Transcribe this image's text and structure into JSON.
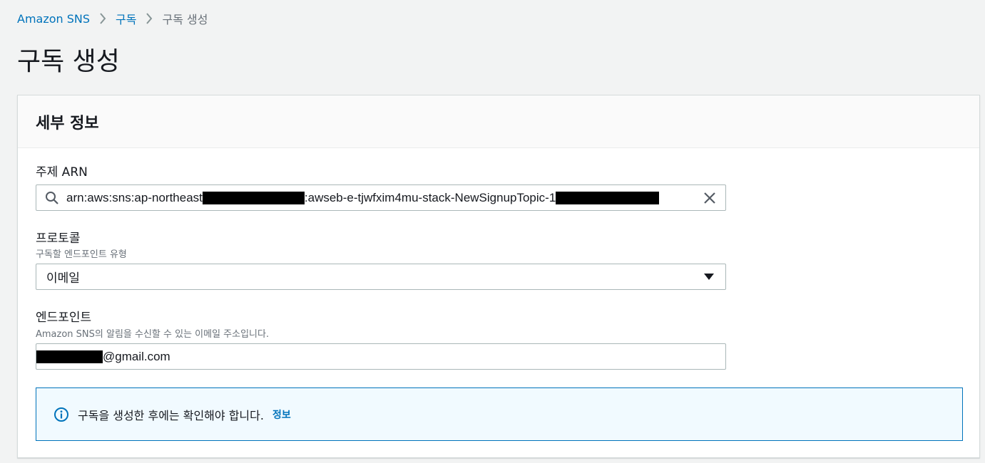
{
  "breadcrumb": {
    "items": [
      "Amazon SNS",
      "구독",
      "구독 생성"
    ]
  },
  "page": {
    "title": "구독 생성"
  },
  "details_panel": {
    "title": "세부 정보",
    "topic_arn": {
      "label": "주제 ARN",
      "value_prefix": "arn:aws:sns:ap-northeast",
      "value_middle": ":awseb-e-tjwfxim4mu-stack-NewSignupTopic-1"
    },
    "protocol": {
      "label": "프로토콜",
      "description": "구독할 엔드포인트 유형",
      "selected": "이메일"
    },
    "endpoint": {
      "label": "엔드포인트",
      "description": "Amazon SNS의 알림을 수신할 수 있는 이메일 주소입니다.",
      "value_suffix": "@gmail.com"
    },
    "alert": {
      "message": "구독을 생성한 후에는 확인해야 합니다.",
      "link": "정보"
    }
  },
  "colors": {
    "link": "#0073bb",
    "background": "#f2f3f3",
    "alert_border": "#0073bb",
    "alert_bg": "#f1faff"
  },
  "icons": [
    "chevron-right-icon",
    "search-icon",
    "close-icon",
    "caret-down-icon",
    "info-icon"
  ]
}
